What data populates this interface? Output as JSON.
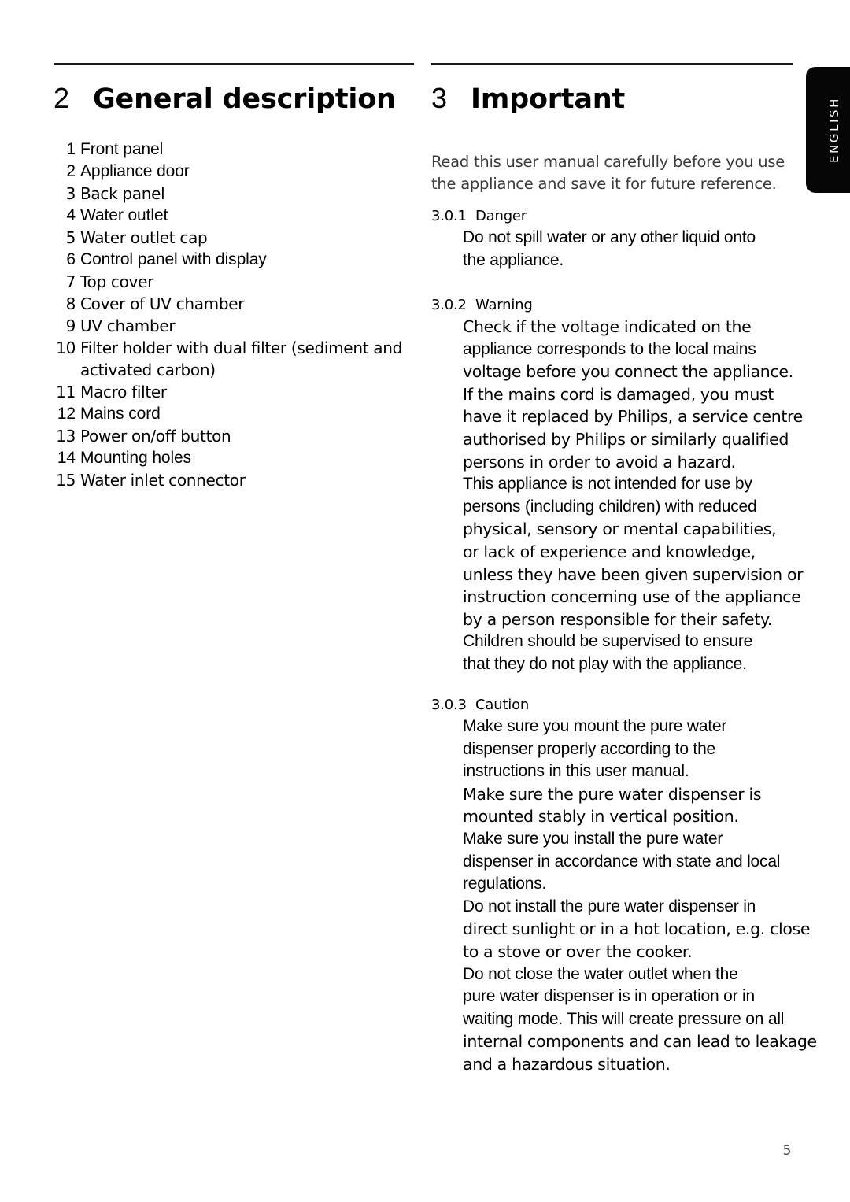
{
  "page": {
    "number": "5",
    "language_tab": "ENGLISH"
  },
  "left_column": {
    "chapter_number": "2",
    "chapter_title": "General description",
    "parts": [
      {
        "num": "1",
        "label": "Front panel"
      },
      {
        "num": "2",
        "label": "Appliance door"
      },
      {
        "num": "3",
        "label": "Back panel"
      },
      {
        "num": "4",
        "label": "Water outlet"
      },
      {
        "num": "5",
        "label": "Water outlet cap"
      },
      {
        "num": "6",
        "label": "Control panel with display"
      },
      {
        "num": "7",
        "label": "Top cover"
      },
      {
        "num": "8",
        "label": "Cover of UV chamber"
      },
      {
        "num": "9",
        "label": "UV chamber"
      },
      {
        "num": "10",
        "label": "Filter holder with dual filter (sediment and"
      },
      {
        "num": "",
        "label": "activated carbon)"
      },
      {
        "num": "11",
        "label": "Macro filter"
      },
      {
        "num": "12",
        "label": "Mains cord"
      },
      {
        "num": "13",
        "label": "Power on/off button"
      },
      {
        "num": "14",
        "label": "Mounting holes"
      },
      {
        "num": "15",
        "label": "Water inlet connector"
      }
    ]
  },
  "right_column": {
    "chapter_number": "3",
    "chapter_title": "Important",
    "intro": "Read this user manual carefully before you use the appliance and save it for future reference.",
    "subsections": [
      {
        "number": "3.0.1",
        "title": "Danger",
        "lines": [
          "Do not spill water or any other liquid onto",
          "the appliance."
        ]
      },
      {
        "number": "3.0.2",
        "title": "Warning",
        "lines": [
          "Check if the voltage indicated on the",
          "appliance corresponds to the local mains",
          "voltage before you connect the appliance.",
          "If the mains cord is damaged, you must",
          "have it replaced by Philips, a service centre",
          "authorised by Philips or similarly qualified",
          "persons in order to avoid a hazard.",
          "This appliance is not intended for use by",
          "persons (including children) with reduced",
          "physical, sensory or mental capabilities,",
          "or lack of experience and knowledge,",
          "unless they have been given supervision or",
          "instruction concerning use of the appliance",
          "by a person responsible for their safety.",
          "Children should be supervised to ensure",
          "that they do not play with the appliance."
        ]
      },
      {
        "number": "3.0.3",
        "title": "Caution",
        "lines": [
          "Make sure you mount the pure water",
          "dispenser properly according to the",
          "instructions in this user manual.",
          "Make sure the pure water dispenser is",
          "mounted stably in vertical position.",
          "Make sure you install the pure water",
          "dispenser in accordance with state and local",
          "regulations.",
          "Do not install the pure water dispenser in",
          "direct sunlight or in a hot location, e.g. close",
          "to a stove or over the cooker.",
          "Do not close the water outlet when the",
          "pure water dispenser is in operation or in",
          "waiting mode. This will create pressure on all",
          "internal components and can lead to leakage",
          "and a hazardous situation."
        ]
      }
    ]
  }
}
